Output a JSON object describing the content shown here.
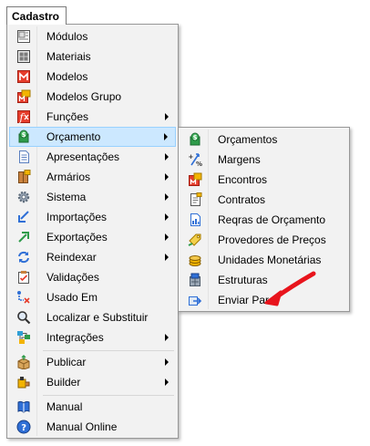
{
  "menubar": {
    "title": "Cadastro"
  },
  "main_menu": {
    "items": [
      {
        "label": "Módulos",
        "icon": "modules-icon"
      },
      {
        "label": "Materiais",
        "icon": "materials-icon"
      },
      {
        "label": "Modelos",
        "icon": "models-icon"
      },
      {
        "label": "Modelos Grupo",
        "icon": "model-group-icon"
      },
      {
        "label": "Funções",
        "icon": "functions-icon"
      },
      {
        "label": "Orçamento",
        "icon": "budget-icon"
      },
      {
        "label": "Apresentações",
        "icon": "presentations-icon"
      },
      {
        "label": "Armários",
        "icon": "cabinets-icon"
      },
      {
        "label": "Sistema",
        "icon": "system-gear-icon"
      },
      {
        "label": "Importações",
        "icon": "import-icon"
      },
      {
        "label": "Exportações",
        "icon": "export-icon"
      },
      {
        "label": "Reindexar",
        "icon": "reindex-icon"
      },
      {
        "label": "Validações",
        "icon": "validations-icon"
      },
      {
        "label": "Usado Em",
        "icon": "used-in-icon"
      },
      {
        "label": "Localizar e Substituir",
        "icon": "search-replace-icon"
      },
      {
        "label": "Integrações",
        "icon": "integrations-icon"
      },
      {
        "label": "Publicar",
        "icon": "publish-icon"
      },
      {
        "label": "Builder",
        "icon": "builder-icon"
      },
      {
        "label": "Manual",
        "icon": "manual-book-icon"
      },
      {
        "label": "Manual Online",
        "icon": "help-icon"
      }
    ]
  },
  "sub_menu": {
    "items": [
      {
        "label": "Orçamentos",
        "icon": "budgets-icon"
      },
      {
        "label": "Margens",
        "icon": "margins-icon"
      },
      {
        "label": "Encontros",
        "icon": "joints-icon"
      },
      {
        "label": "Contratos",
        "icon": "contracts-icon"
      },
      {
        "label": "Reqras de Orçamento",
        "icon": "budget-rules-icon"
      },
      {
        "label": "Provedores de Preços",
        "icon": "price-providers-icon"
      },
      {
        "label": "Unidades Monetárias",
        "icon": "currency-units-icon"
      },
      {
        "label": "Estruturas",
        "icon": "structures-icon"
      },
      {
        "label": "Enviar Para",
        "icon": "send-to-icon"
      }
    ]
  },
  "colors": {
    "highlight": "#cce8ff",
    "highlight_border": "#99d1ff",
    "annotation_arrow": "#e8141c"
  }
}
